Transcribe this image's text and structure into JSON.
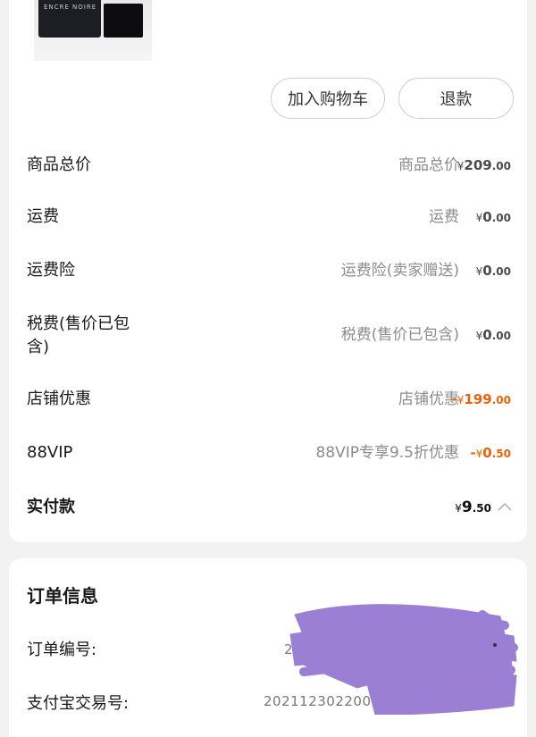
{
  "product": {
    "thumb_text": "ENCRE NOIRE"
  },
  "actions": {
    "add_to_cart": "加入购物车",
    "refund": "退款"
  },
  "price_rows": [
    {
      "label": "商品总价",
      "desc": "商品总价",
      "currency": "¥",
      "integer": "209",
      "decimal": ".00"
    },
    {
      "label": "运费",
      "desc": "运费",
      "currency": "¥",
      "integer": "0",
      "decimal": ".00"
    },
    {
      "label": "运费险",
      "desc": "运费险(卖家赠送)",
      "currency": "¥",
      "integer": "0",
      "decimal": ".00"
    },
    {
      "label_line1": "税费(售价已包",
      "label_line2": "含)",
      "desc": "税费(售价已包含)",
      "currency": "¥",
      "integer": "0",
      "decimal": ".00"
    },
    {
      "label": "店铺优惠",
      "desc": "店铺优惠",
      "sign": "-",
      "currency": "¥",
      "integer": "199",
      "decimal": ".00"
    },
    {
      "label": "88VIP",
      "desc": "88VIP专享9.5折优惠",
      "sign": "-",
      "currency": "¥",
      "integer": "0",
      "decimal": ".50"
    }
  ],
  "total": {
    "label": "实付款",
    "currency": "¥",
    "integer": "9",
    "decimal": ".50"
  },
  "order_info": {
    "title": "订单信息",
    "order_no_label": "订单编号:",
    "order_no_value": "2",
    "alipay_label": "支付宝交易号:",
    "alipay_value": "20211230220011"
  },
  "colors": {
    "discount": "#e8630a",
    "scribble": "#9b7fd4",
    "background": "#f2f2f2"
  },
  "icons": {
    "collapse": "chevron-up-icon"
  }
}
